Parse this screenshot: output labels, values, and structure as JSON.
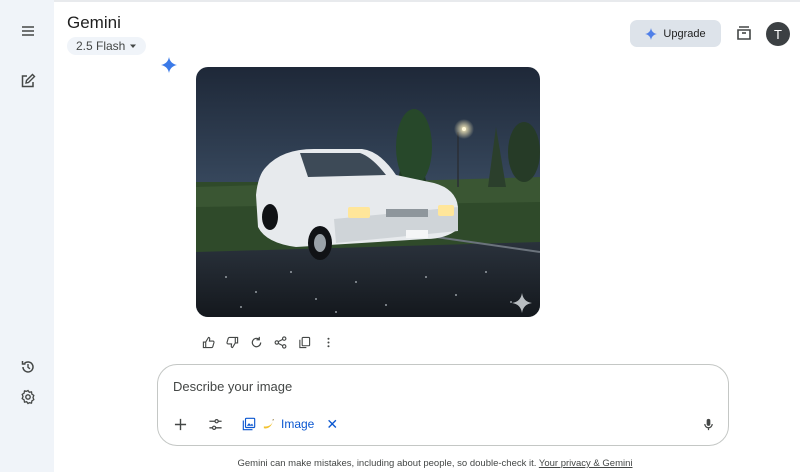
{
  "app": {
    "title": "Gemini",
    "model": "2.5 Flash"
  },
  "header": {
    "upgrade_label": "Upgrade",
    "avatar_initial": "T"
  },
  "composer": {
    "placeholder": "Describe your image",
    "tool_chip_label": "Image",
    "tool_chip_close": "✕"
  },
  "footer": {
    "text": "Gemini can make mistakes, including about people, so double-check it.",
    "link": "Your privacy & Gemini"
  },
  "icons": {
    "sidebar": [
      "menu-icon",
      "new-chat-icon",
      "history-icon",
      "settings-icon"
    ],
    "response_actions": [
      "thumbs-up-icon",
      "thumbs-down-icon",
      "redo-icon",
      "share-icon",
      "copy-icon",
      "more-vert-icon"
    ],
    "composer": [
      "add-icon",
      "tools-icon",
      "image-tool-icon",
      "mic-icon"
    ]
  },
  "colors": {
    "accent": "#0b57d0",
    "sidebar": "#f0f4f9",
    "upgrade_bg": "#dde3ea",
    "avatar_bg": "#3c4043"
  }
}
